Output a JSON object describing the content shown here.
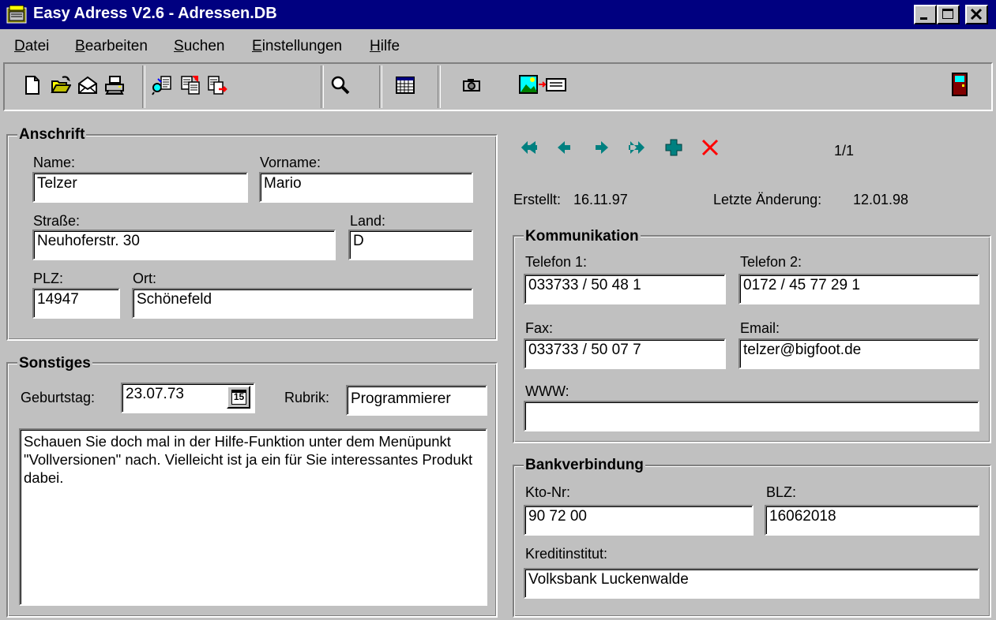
{
  "window": {
    "title": "Easy Adress V2.6 - Adressen.DB"
  },
  "menu": {
    "items": [
      {
        "mnemonic": "D",
        "rest": "atei"
      },
      {
        "mnemonic": "B",
        "rest": "earbeiten"
      },
      {
        "mnemonic": "S",
        "rest": "uchen"
      },
      {
        "mnemonic": "E",
        "rest": "instellungen"
      },
      {
        "mnemonic": "H",
        "rest": "ilfe"
      }
    ]
  },
  "toolbar": {
    "icons": [
      "new-file-icon",
      "open-folder-icon",
      "envelope-icon",
      "print-icon",
      "find-replace-icon",
      "copy-record-icon",
      "export-record-icon",
      "search-icon",
      "calendar-grid-icon",
      "camera-icon",
      "image-to-list-icon",
      "exit-door-icon"
    ]
  },
  "anschrift": {
    "title": "Anschrift",
    "name_label": "Name:",
    "name": "Telzer",
    "vorname_label": "Vorname:",
    "vorname": "Mario",
    "strasse_label": "Straße:",
    "strasse": "Neuhoferstr. 30",
    "land_label": "Land:",
    "land": "D",
    "plz_label": "PLZ:",
    "plz": "14947",
    "ort_label": "Ort:",
    "ort": "Schönefeld"
  },
  "sonstiges": {
    "title": "Sonstiges",
    "geburtstag_label": "Geburtstag:",
    "geburtstag": "23.07.73",
    "calendar_button_label": "15",
    "rubrik_label": "Rubrik:",
    "rubrik": "Programmierer",
    "notes": "Schauen Sie doch mal in der Hilfe-Funktion unter dem Menüpunkt \"Vollversionen\" nach. Vielleicht ist ja ein für Sie interessantes Produkt dabei."
  },
  "navigation": {
    "page": "1/1",
    "erstellt_label": "Erstellt:",
    "erstellt": "16.11.97",
    "aenderung_label": "Letzte Änderung:",
    "aenderung": "12.01.98",
    "colors": {
      "arrow": "#008080",
      "delete": "#ff0000"
    }
  },
  "kommunikation": {
    "title": "Kommunikation",
    "telefon1_label": "Telefon 1:",
    "telefon1": "033733 / 50 48 1",
    "telefon2_label": "Telefon 2:",
    "telefon2": "0172 / 45 77 29 1",
    "fax_label": "Fax:",
    "fax": "033733 / 50 07 7",
    "email_label": "Email:",
    "email": "telzer@bigfoot.de",
    "www_label": "WWW:",
    "www": ""
  },
  "bank": {
    "title": "Bankverbindung",
    "kto_label": "Kto-Nr:",
    "kto": "90 72 00",
    "blz_label": "BLZ:",
    "blz": "16062018",
    "institut_label": "Kreditinstitut:",
    "institut": "Volksbank Luckenwalde"
  }
}
